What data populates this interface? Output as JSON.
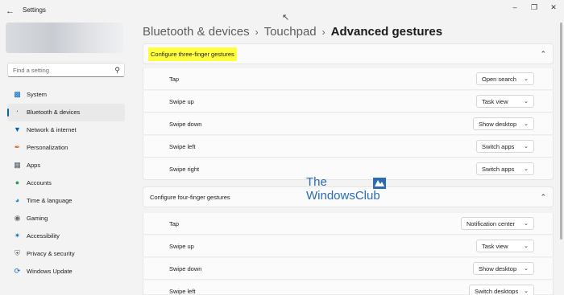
{
  "window": {
    "title": "Settings",
    "back_icon": "arrow-left-icon",
    "controls": [
      "minimize-icon",
      "maximize-icon",
      "close-icon"
    ]
  },
  "search": {
    "placeholder": "Find a setting"
  },
  "sidebar": {
    "items": [
      {
        "label": "System",
        "icon": "monitor-icon",
        "active": false
      },
      {
        "label": "Bluetooth & devices",
        "icon": "bluetooth-icon",
        "active": true
      },
      {
        "label": "Network & internet",
        "icon": "wifi-icon",
        "active": false
      },
      {
        "label": "Personalization",
        "icon": "brush-icon",
        "active": false
      },
      {
        "label": "Apps",
        "icon": "apps-icon",
        "active": false
      },
      {
        "label": "Accounts",
        "icon": "person-icon",
        "active": false
      },
      {
        "label": "Time & language",
        "icon": "globe-clock-icon",
        "active": false
      },
      {
        "label": "Gaming",
        "icon": "controller-icon",
        "active": false
      },
      {
        "label": "Accessibility",
        "icon": "accessibility-icon",
        "active": false
      },
      {
        "label": "Privacy & security",
        "icon": "shield-icon",
        "active": false
      },
      {
        "label": "Windows Update",
        "icon": "update-icon",
        "active": false
      }
    ]
  },
  "breadcrumb": {
    "items": [
      "Bluetooth & devices",
      "Touchpad"
    ],
    "current": "Advanced gestures"
  },
  "three_finger": {
    "title": "Configure three-finger gestures",
    "rows": [
      {
        "label": "Tap",
        "value": "Open search"
      },
      {
        "label": "Swipe up",
        "value": "Task view"
      },
      {
        "label": "Swipe down",
        "value": "Show desktop"
      },
      {
        "label": "Swipe left",
        "value": "Switch apps"
      },
      {
        "label": "Swipe right",
        "value": "Switch apps"
      }
    ]
  },
  "four_finger": {
    "title": "Configure four-finger gestures",
    "rows": [
      {
        "label": "Tap",
        "value": "Notification center"
      },
      {
        "label": "Swipe up",
        "value": "Task view"
      },
      {
        "label": "Swipe down",
        "value": "Show desktop"
      },
      {
        "label": "Swipe left",
        "value": "Switch desktops"
      }
    ]
  },
  "watermark": {
    "line1": "The",
    "line2": "WindowsClub"
  },
  "colors": {
    "accent": "#0067c0",
    "highlight": "#ffff3d"
  }
}
